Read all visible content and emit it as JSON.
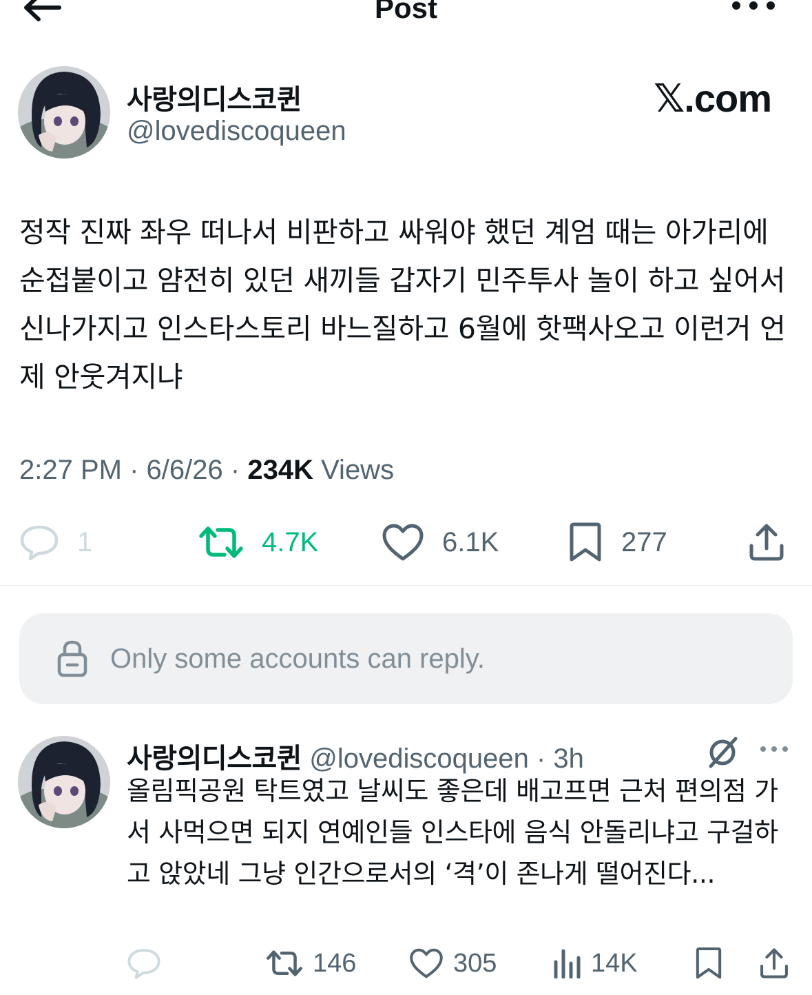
{
  "header": {
    "title": "Post",
    "back_icon": "arrow-left-icon",
    "more_icon": "more-horizontal-icon"
  },
  "post": {
    "author_name": "사랑의디스코퀸",
    "author_handle": "@lovediscoqueen",
    "brand": "𝕏.com",
    "text": "정작 진짜 좌우 떠나서 비판하고 싸워야 했던 계엄 때는 아가리에 순접붙이고 얌전히 있던 새끼들 갑자기 민주투사 놀이 하고 싶어서 신나가지고 인스타스토리 바느질하고 6월에 핫팩사오고 이런거 언제 안웃겨지냐",
    "time": "2:27 PM",
    "date": "6/6/26",
    "separator": "·",
    "views_count": "234K",
    "views_label": "Views",
    "replies": "1",
    "reposts": "4.7K",
    "likes": "6.1K",
    "bookmarks": "277",
    "repost_color": "#00ba7c"
  },
  "reply_restriction": {
    "text": "Only some accounts can reply.",
    "icon": "lock-icon"
  },
  "reply": {
    "author_name": "사랑의디스코퀸",
    "author_handle": "@lovediscoqueen",
    "separator": "·",
    "age": "3h",
    "text": "올림픽공원 탁트였고 날씨도 좋은데 배고프면 근처 편의점 가서 사먹으면 되지 연예인들 인스타에 음식 안돌리냐고 구걸하고 앉았네 그냥 인간으로서의 ‘격’이 존나게 떨어진다...",
    "reposts": "146",
    "likes": "305",
    "views": "14K"
  }
}
